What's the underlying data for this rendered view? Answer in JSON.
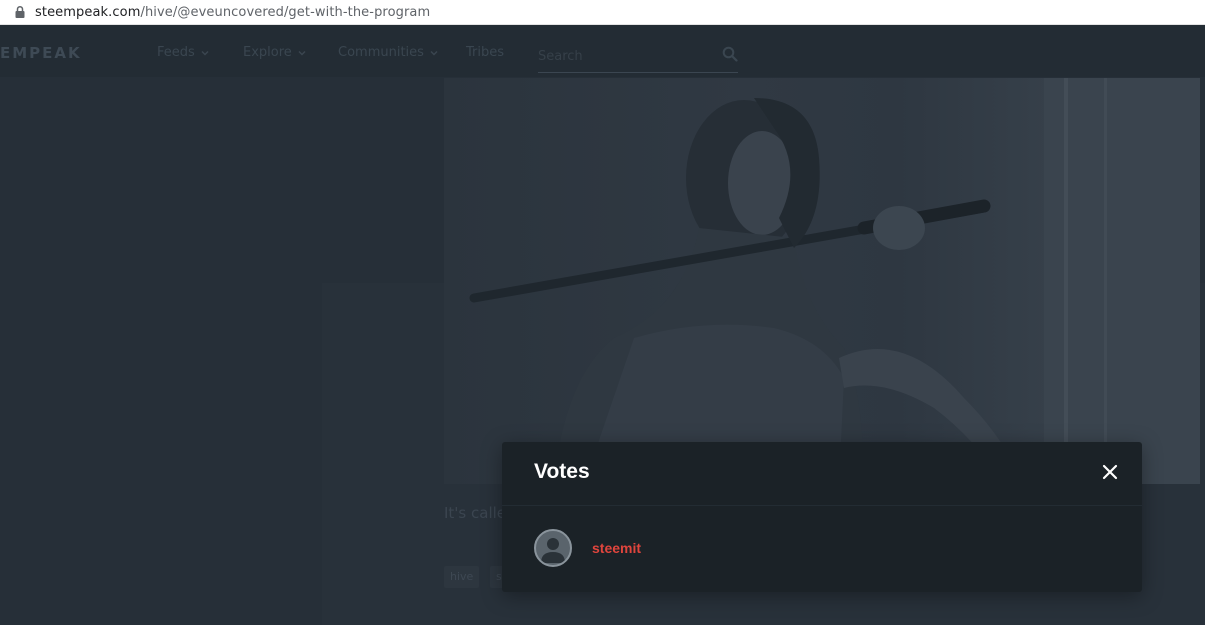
{
  "browser": {
    "url_domain": "steempeak.com",
    "url_path": "/hive/@eveuncovered/get-with-the-program"
  },
  "nav": {
    "logo": "EMPEAK",
    "items": [
      {
        "label": "Feeds"
      },
      {
        "label": "Explore"
      },
      {
        "label": "Communities"
      },
      {
        "label": "Tribes"
      }
    ],
    "search_placeholder": "Search"
  },
  "post": {
    "body_excerpt": "It's calle",
    "tags": [
      "hive",
      "s"
    ]
  },
  "modal": {
    "title": "Votes",
    "voters": [
      {
        "name": "steemit"
      }
    ]
  },
  "colors": {
    "accent": "#e0453d",
    "modal_bg": "#1b2227",
    "page_bg": "#262f38"
  }
}
